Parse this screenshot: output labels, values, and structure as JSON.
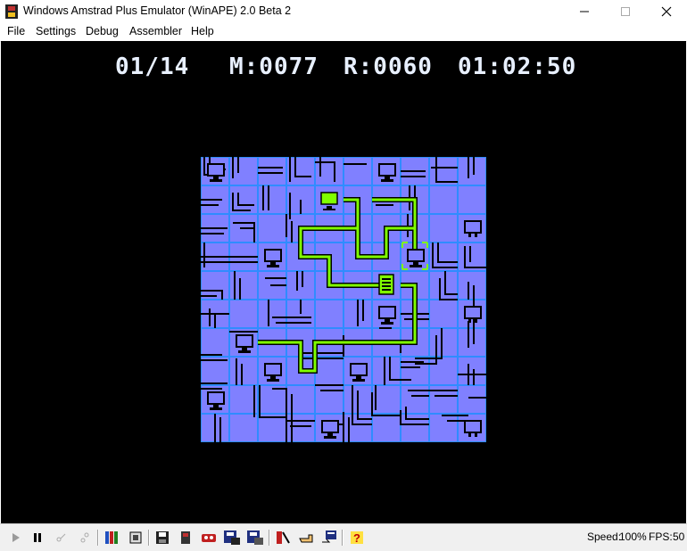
{
  "window": {
    "title": "Windows Amstrad Plus Emulator (WinAPE) 2.0 Beta 2"
  },
  "menu": [
    "File",
    "Settings",
    "Debug",
    "Assembler",
    "Help"
  ],
  "hud": {
    "level": "01/14",
    "moves": "M:0077",
    "rotations": "R:0060",
    "timer": "01:02:50"
  },
  "status": {
    "speed_label": "Speed:",
    "speed_value": "100%",
    "fps_label": "FPS:",
    "fps_value": "50"
  },
  "colors": {
    "board_bg": "#8080ff",
    "grid_lines": "#2f8cff",
    "pipes": "#000000",
    "connected_pipes": "#80ff00",
    "hud_text": "#e8f0ff"
  },
  "icons": {
    "play": "play-icon",
    "pause": "pause-icon",
    "step": "step-icon",
    "step2": "step-over-icon",
    "tape": "tape-icon",
    "disc": "disc-icon",
    "save": "floppy-icon",
    "help": "help-icon"
  }
}
